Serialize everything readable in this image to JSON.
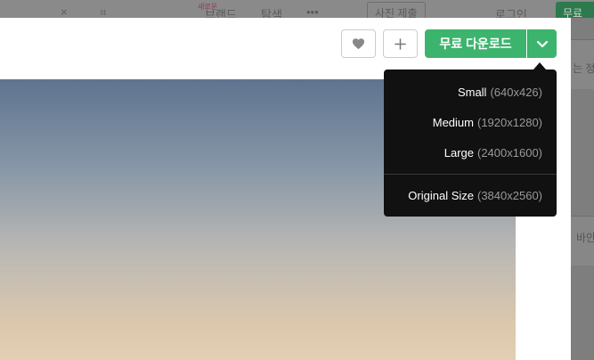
{
  "background": {
    "nav_new_tag": "새로운",
    "nav_brand": "브랜드",
    "nav_explore": "탐색",
    "nav_more": "•••",
    "submit_photo": "사진 제출",
    "login": "로그인",
    "join": "무료",
    "side_text_1": "는 정",
    "side_text_2": "바안"
  },
  "toolbar": {
    "like_icon": "heart-icon",
    "add_icon": "plus-icon",
    "download_label": "무료 다운로드",
    "toggle_icon": "chevron-down-icon",
    "accent_color": "#3cb46e"
  },
  "download_menu": {
    "items": [
      {
        "name": "Small",
        "size": "(640x426)"
      },
      {
        "name": "Medium",
        "size": "(1920x1280)"
      },
      {
        "name": "Large",
        "size": "(2400x1600)"
      }
    ],
    "original": {
      "name": "Original Size",
      "size": "(3840x2560)"
    }
  }
}
